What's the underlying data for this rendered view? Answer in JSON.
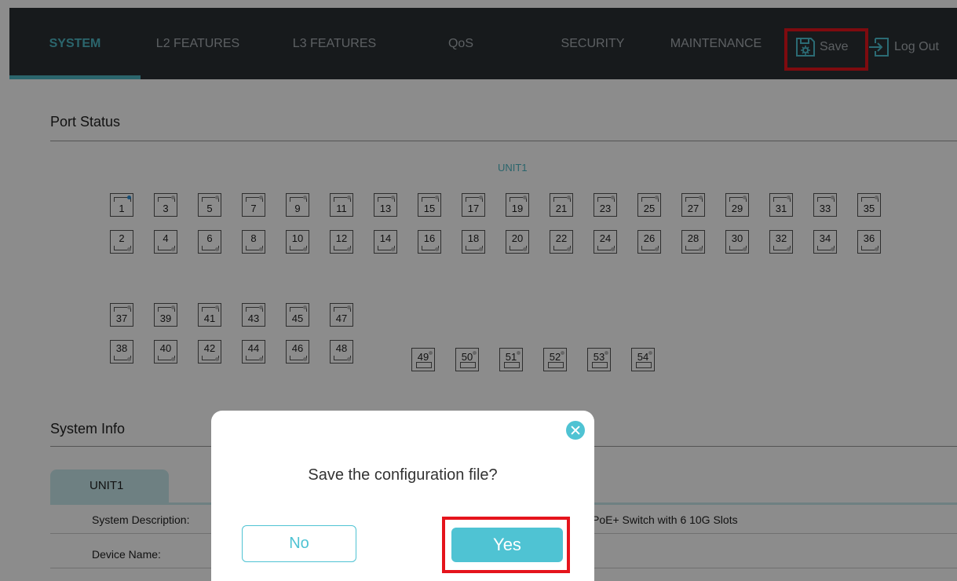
{
  "nav": {
    "tabs": [
      {
        "label": "SYSTEM",
        "active": true
      },
      {
        "label": "L2 FEATURES"
      },
      {
        "label": "L3 FEATURES"
      },
      {
        "label": "QoS"
      },
      {
        "label": "SECURITY"
      },
      {
        "label": "MAINTENANCE"
      }
    ],
    "save_label": "Save",
    "save_icon": "floppy-gear-icon",
    "logout_label": "Log Out",
    "logout_icon": "logout-arrow-icon"
  },
  "port_status": {
    "title": "Port Status",
    "unit_label": "UNIT1",
    "rows": [
      [
        "1",
        "3",
        "5",
        "7",
        "9",
        "11",
        "13",
        "15",
        "17",
        "19",
        "21",
        "23",
        "25",
        "27",
        "29",
        "31",
        "33",
        "35"
      ],
      [
        "2",
        "4",
        "6",
        "8",
        "10",
        "12",
        "14",
        "16",
        "18",
        "20",
        "22",
        "24",
        "26",
        "28",
        "30",
        "32",
        "34",
        "36"
      ],
      [
        "37",
        "39",
        "41",
        "43",
        "45",
        "47"
      ],
      [
        "38",
        "40",
        "42",
        "44",
        "46",
        "48"
      ]
    ],
    "sfp_ports": [
      "49",
      "50",
      "51",
      "52",
      "53",
      "54"
    ],
    "active_ports": [
      "1"
    ]
  },
  "system_info": {
    "title": "System Info",
    "tab_label": "UNIT1",
    "rows": [
      {
        "label": "System Description:",
        "value": "PoE+ Switch with 6 10G Slots"
      },
      {
        "label": "Device Name:",
        "value": ""
      }
    ]
  },
  "dialog": {
    "message": "Save the configuration file?",
    "no_label": "No",
    "yes_label": "Yes"
  },
  "colors": {
    "accent": "#4fc3d3",
    "nav_bg": "#2a3034",
    "highlight": "#e5141c"
  }
}
